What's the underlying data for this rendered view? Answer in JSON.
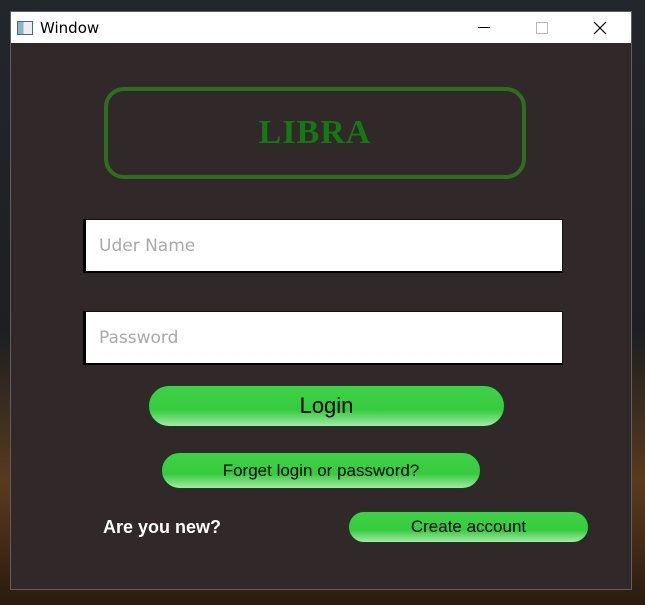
{
  "window": {
    "title": "Window"
  },
  "logo": {
    "text": "LIBRA"
  },
  "username": {
    "placeholder": "Uder Name",
    "value": ""
  },
  "password": {
    "placeholder": "Password",
    "value": ""
  },
  "buttons": {
    "login": "Login",
    "forget": "Forget login or password?",
    "create": "Create account"
  },
  "new_user": {
    "label": "Are you new?"
  },
  "icons": {
    "app": "app-window-icon",
    "minimize": "minimize-icon",
    "maximize": "maximize-icon",
    "close": "close-icon"
  },
  "colors": {
    "background": "#302829",
    "logo_border": "#2e6f1e",
    "logo_text": "#137a10",
    "button_green": "#36cc3e"
  }
}
